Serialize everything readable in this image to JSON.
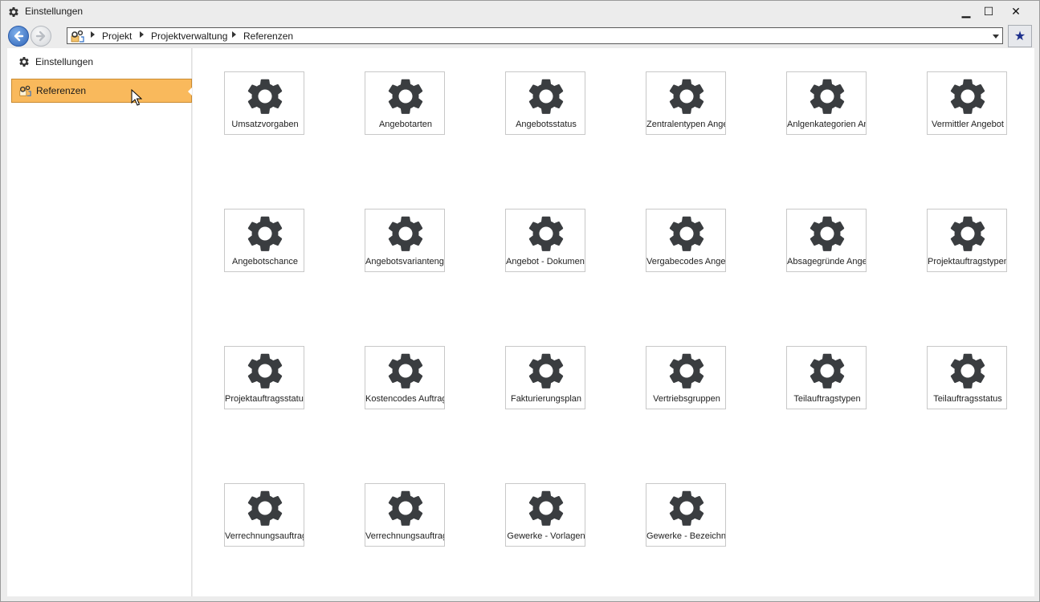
{
  "window": {
    "title": "Einstellungen",
    "minimize": "▁",
    "maximize": "☐",
    "close": "✕"
  },
  "nav": {
    "back_icon": "back-arrow-icon",
    "forward_icon": "forward-arrow-icon",
    "breadcrumb": [
      "Projekt",
      "Projektverwaltung",
      "Referenzen"
    ],
    "favorite_icon": "star-icon"
  },
  "sidebar": {
    "items": [
      {
        "label": "Einstellungen",
        "icon": "gear-icon",
        "active": false
      },
      {
        "label": "Referenzen",
        "icon": "references-icon",
        "active": true
      }
    ]
  },
  "tiles": [
    "Umsatzvorgaben",
    "Angebotarten",
    "Angebotsstatus",
    "Zentralentypen Angebot",
    "Anlgenkategorien Angebot",
    "Vermittler Angebot",
    "Angebotschance",
    "Angebotsvariantengruppen",
    "Angebot - Dokumente",
    "Vergabecodes Angebot",
    "Absagegründe Angebot",
    "Projektauftragstypen",
    "Projektauftragsstatus",
    "Kostencodes Auftrag",
    "Fakturierungsplan",
    "Vertriebsgruppen",
    "Teilauftragstypen",
    "Teilauftragsstatus",
    "Verrechnungsauftragstypen",
    "Verrechnungsauftragsstatus",
    "Gewerke - Vorlagen",
    "Gewerke - Bezeichnungen"
  ],
  "colors": {
    "active_item": "#f9b95c",
    "gear": "#3a3d40",
    "favorite_star": "#1c2f8c"
  }
}
